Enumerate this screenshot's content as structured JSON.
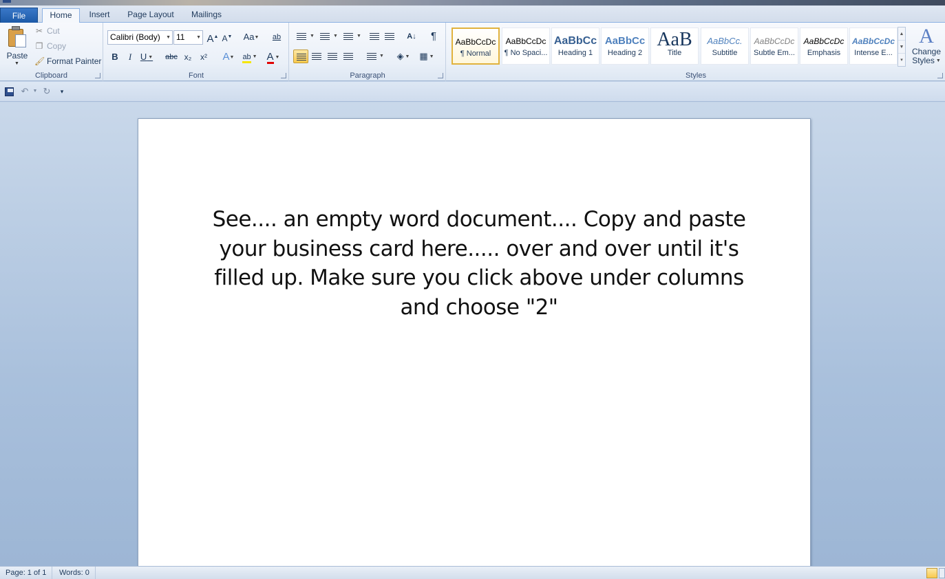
{
  "ribbon_tabs": {
    "file": "File",
    "home": "Home",
    "insert": "Insert",
    "page_layout": "Page Layout",
    "mailings": "Mailings"
  },
  "clipboard": {
    "paste": "Paste",
    "cut": "Cut",
    "copy": "Copy",
    "format_painter": "Format Painter",
    "label": "Clipboard"
  },
  "font": {
    "font_name": "Calibri (Body)",
    "font_size": "11",
    "grow": "A",
    "shrink": "A",
    "change_case": "Aa",
    "bold": "B",
    "italic": "I",
    "underline": "U",
    "strikethrough": "abc",
    "subscript": "x₂",
    "superscript": "x²",
    "text_effects": "A",
    "highlight": "ab",
    "font_color": "A",
    "label": "Font"
  },
  "paragraph": {
    "pilcrow": "¶",
    "sort": "A↓",
    "label": "Paragraph"
  },
  "styles": {
    "items": [
      {
        "sample": "AaBbCcDc",
        "name": "¶ Normal"
      },
      {
        "sample": "AaBbCcDc",
        "name": "¶ No Spaci..."
      },
      {
        "sample": "AaBbCc",
        "name": "Heading 1"
      },
      {
        "sample": "AaBbCc",
        "name": "Heading 2"
      },
      {
        "sample": "AaB",
        "name": "Title"
      },
      {
        "sample": "AaBbCc.",
        "name": "Subtitle"
      },
      {
        "sample": "AaBbCcDc",
        "name": "Subtle Em..."
      },
      {
        "sample": "AaBbCcDc",
        "name": "Emphasis"
      },
      {
        "sample": "AaBbCcDc",
        "name": "Intense E..."
      }
    ],
    "change_styles_line1": "Change",
    "change_styles_line2": "Styles",
    "label": "Styles"
  },
  "document": {
    "body_text": "See.... an empty word document.... Copy and paste your business card here..... over and over until it's filled up. Make sure you click above under columns and choose \"2\""
  },
  "status": {
    "page": "Page: 1 of 1",
    "words": "Words: 0"
  },
  "colors": {
    "accent": "#1d5aa8",
    "selected_style": "#e1b23c",
    "page_background": "#ffffff"
  }
}
